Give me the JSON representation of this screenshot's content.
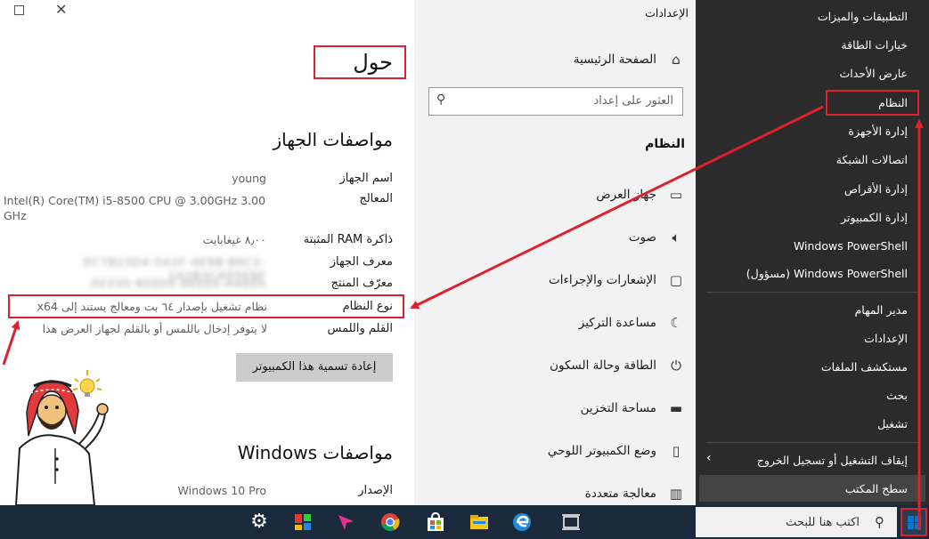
{
  "about": {
    "heading": "حول",
    "device_specs_title": "مواصفات الجهاز",
    "specs": [
      {
        "label": "اسم الجهاز",
        "value": "young"
      },
      {
        "label": "المعالج",
        "value": "Intel(R) Core(TM) i5-8500 CPU @ 3.00GHz   3.00 GHz"
      },
      {
        "label": "ذاكرة RAM المثبتة",
        "value": "٨٫٠٠ غيغابايت"
      },
      {
        "label": "معرف الجهاز",
        "value": "0C7B23D4-5A1F-4E9B-B6C2-1A2B3C4D5E6F"
      },
      {
        "label": "معرّف المنتج",
        "value": "00330-80000-00000-AA000"
      },
      {
        "label": "نوع النظام",
        "value": "نظام تشغيل بإصدار ٦٤ بت ومعالج يستند إلى x64"
      },
      {
        "label": "القلم واللمس",
        "value": "لا يتوفر إدخال باللمس أو بالقلم لجهاز العرض هذا"
      }
    ],
    "rename_button": "إعادة تسمية هذا الكمبيوتر",
    "windows_specs_title": "مواصفات Windows",
    "edition_label": "الإصدار",
    "edition_value": "Windows 10 Pro"
  },
  "nav": {
    "window_title": "الإعدادات",
    "home": "الصفحة الرئيسية",
    "search_placeholder": "العثور على إعداد",
    "section_title": "النظام",
    "items": [
      {
        "label": "جهاز العرض",
        "icon": "display-icon"
      },
      {
        "label": "صوت",
        "icon": "speaker-icon"
      },
      {
        "label": "الإشعارات والإجراءات",
        "icon": "notification-icon"
      },
      {
        "label": "مساعدة التركيز",
        "icon": "moon-icon"
      },
      {
        "label": "الطاقة وحالة السكون",
        "icon": "power-icon"
      },
      {
        "label": "مساحة التخزين",
        "icon": "storage-icon"
      },
      {
        "label": "وضع الكمبيوتر اللوحي",
        "icon": "tablet-icon"
      },
      {
        "label": "معالجة متعددة",
        "icon": "multitasking-icon"
      }
    ]
  },
  "winx": {
    "group1": [
      "التطبيقات والميزات",
      "خيارات الطاقة",
      "عارض الأحداث",
      "النظام",
      "إدارة الأجهزة",
      "اتصالات الشبكة",
      "إدارة الأقراص",
      "إدارة الكمبيوتر",
      "Windows PowerShell",
      "Windows PowerShell (مسؤول)"
    ],
    "group2": [
      "مدير المهام",
      "الإعدادات",
      "مستكشف الملفات",
      "بحث",
      "تشغيل"
    ],
    "shutdown": "إيقاف التشغيل أو تسجيل الخروج",
    "desktop": "سطح المكتب"
  },
  "taskbar": {
    "search_placeholder": "اكتب هنا للبحث"
  },
  "colors": {
    "annotation_red": "#e0212b",
    "menu_dark": "#2b2b2b",
    "nav_gray": "#f2f2f2",
    "taskbar": "#1a2a3c",
    "windows_blue": "#0078d7"
  }
}
